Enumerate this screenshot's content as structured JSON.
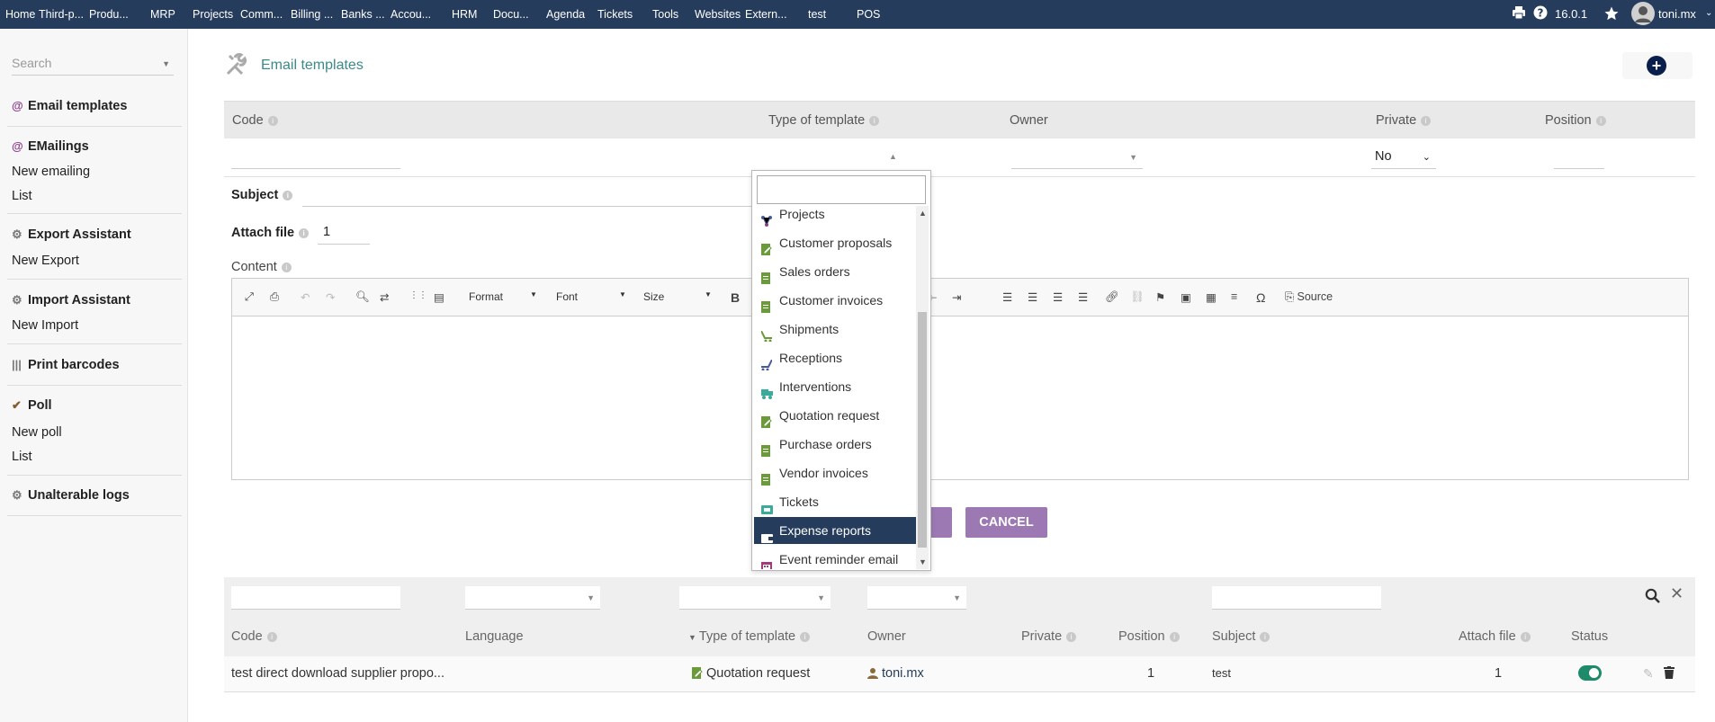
{
  "topbar": {
    "menus": [
      "Home",
      "Third-p...",
      "Produ...",
      "MRP",
      "Projects",
      "Comm...",
      "Billing ...",
      "Banks ...",
      "Accou...",
      "HRM",
      "Docu...",
      "Agenda",
      "Tickets",
      "Tools",
      "Websites",
      "Extern...",
      "test",
      "POS"
    ],
    "version": "16.0.1",
    "user": "toni.mx",
    "icons": [
      "print-icon",
      "help-icon",
      "star-icon",
      "avatar"
    ]
  },
  "sidebar": {
    "search_placeholder": "Search",
    "sections": [
      {
        "title": "Email templates",
        "icon": "at-icon",
        "items": []
      },
      {
        "title": "EMailings",
        "icon": "at-icon",
        "items": [
          "New emailing",
          "List"
        ]
      },
      {
        "title": "Export Assistant",
        "icon": "gears-icon",
        "items": [
          "New Export"
        ]
      },
      {
        "title": "Import Assistant",
        "icon": "gears-icon",
        "items": [
          "New Import"
        ]
      },
      {
        "title": "Print barcodes",
        "icon": "barcode-icon",
        "items": []
      },
      {
        "title": "Poll",
        "icon": "check-icon",
        "items": [
          "New poll",
          "List"
        ]
      },
      {
        "title": "Unalterable logs",
        "icon": "gears-icon",
        "items": []
      }
    ]
  },
  "main": {
    "title": "Email templates",
    "form_headers": {
      "code": "Code",
      "type": "Type of template",
      "owner": "Owner",
      "private": "Private",
      "position": "Position"
    },
    "private_value": "No",
    "subject_label": "Subject",
    "attach_label": "Attach file",
    "attach_value": "1",
    "content_label": "Content",
    "toolbar": {
      "format": "Format",
      "font": "Font",
      "size": "Size",
      "bold": "B",
      "source": "Source",
      "omega": "Ω"
    },
    "cancel_label": "CANCEL"
  },
  "dropdown": {
    "options": [
      {
        "label": "Projects",
        "color": "#4a5b9a"
      },
      {
        "label": "Customer proposals",
        "color": "#6a9a3a"
      },
      {
        "label": "Sales orders",
        "color": "#6a9a3a"
      },
      {
        "label": "Customer invoices",
        "color": "#6a9a3a"
      },
      {
        "label": "Shipments",
        "color": "#6a9a3a"
      },
      {
        "label": "Receptions",
        "color": "#4a5b9a"
      },
      {
        "label": "Interventions",
        "color": "#3aaa9a"
      },
      {
        "label": "Quotation request",
        "color": "#6a9a3a"
      },
      {
        "label": "Purchase orders",
        "color": "#6a9a3a"
      },
      {
        "label": "Vendor invoices",
        "color": "#6a9a3a"
      },
      {
        "label": "Tickets",
        "color": "#3aaa9a"
      },
      {
        "label": "Expense reports",
        "color": "#ffffff"
      },
      {
        "label": "Event reminder email",
        "color": "#a03a7a"
      }
    ],
    "selected": "Expense reports"
  },
  "list": {
    "headers": {
      "code": "Code",
      "language": "Language",
      "type": "Type of template",
      "owner": "Owner",
      "private": "Private",
      "position": "Position",
      "subject": "Subject",
      "attach": "Attach file",
      "status": "Status"
    },
    "rows": [
      {
        "code": "test direct download supplier propo...",
        "language": "",
        "type": "Quotation request",
        "owner": "toni.mx",
        "private": "",
        "position": "1",
        "subject": "test",
        "attach": "1",
        "status": "enabled"
      }
    ]
  }
}
